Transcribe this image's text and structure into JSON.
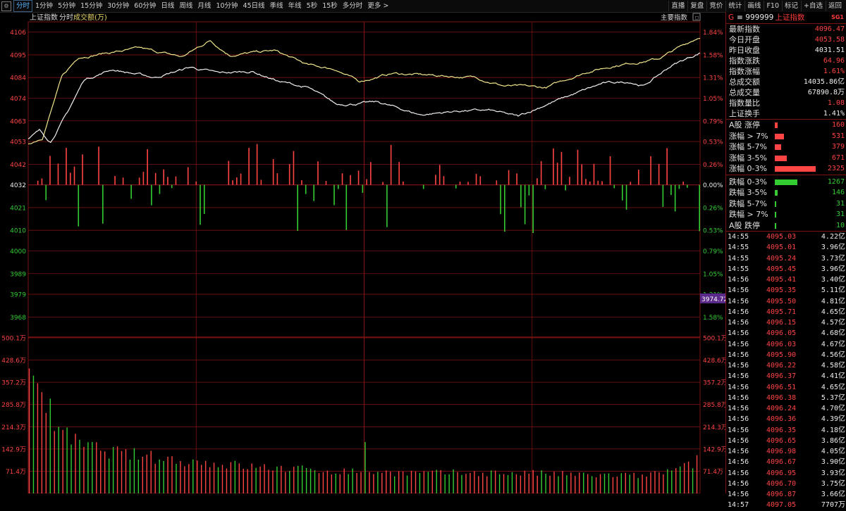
{
  "toolbar": {
    "tabs": [
      "分时",
      "1分钟",
      "5分钟",
      "15分钟",
      "30分钟",
      "60分钟",
      "日线",
      "周线",
      "月线",
      "10分钟",
      "45日线",
      "季线",
      "年线",
      "5秒",
      "15秒",
      "多分时",
      "更多 >"
    ],
    "active_tab": "分时",
    "right_buttons": [
      "直播",
      "复盘",
      "竞价",
      "统计",
      "画线",
      "F10",
      "标记",
      "+自选",
      "返回"
    ]
  },
  "chart_header": {
    "name": "上证指数",
    "mode": "分时",
    "volume_label": "成交额(万)",
    "indicator_button": "主要指数"
  },
  "sidebar": {
    "header": {
      "g": "G",
      "code": "≡ 999999",
      "name": "上证指数",
      "badge": "SG1"
    },
    "quote": [
      {
        "label": "最新指数",
        "value": "4096.47",
        "color": "red"
      },
      {
        "label": "今日开盘",
        "value": "4053.58",
        "color": "red"
      },
      {
        "label": "昨日收盘",
        "value": "4031.51",
        "color": "white"
      },
      {
        "label": "指数涨跌",
        "value": "64.96",
        "color": "red"
      },
      {
        "label": "指数涨幅",
        "value": "1.61%",
        "color": "red"
      },
      {
        "label": "总成交额",
        "value": "14035.86亿",
        "color": "white"
      },
      {
        "label": "总成交量",
        "value": "67890.8万",
        "color": "white"
      },
      {
        "label": "指数量比",
        "value": "1.08",
        "color": "red"
      },
      {
        "label": "上证换手",
        "value": "1.41%",
        "color": "white"
      }
    ],
    "breadth_up": [
      {
        "label": "A股 涨停",
        "value": "160"
      },
      {
        "label": "涨幅 > 7%",
        "value": "531"
      },
      {
        "label": "涨幅 5-7%",
        "value": "379"
      },
      {
        "label": "涨幅 3-5%",
        "value": "671"
      },
      {
        "label": "涨幅 0-3%",
        "value": "2325"
      }
    ],
    "breadth_down": [
      {
        "label": "跌幅 0-3%",
        "value": "1267"
      },
      {
        "label": "跌幅 3-5%",
        "value": "146"
      },
      {
        "label": "跌幅 5-7%",
        "value": "31"
      },
      {
        "label": "跌幅 > 7%",
        "value": "31"
      },
      {
        "label": "A股 跌停",
        "value": "10"
      }
    ],
    "ticks": [
      {
        "time": "14:55",
        "price": "4095.03",
        "amount": "4.22",
        "unit": "亿"
      },
      {
        "time": "14:55",
        "price": "4095.01",
        "amount": "3.96",
        "unit": "亿"
      },
      {
        "time": "14:55",
        "price": "4095.24",
        "amount": "3.73",
        "unit": "亿"
      },
      {
        "time": "14:55",
        "price": "4095.45",
        "amount": "3.96",
        "unit": "亿"
      },
      {
        "time": "14:56",
        "price": "4095.41",
        "amount": "3.40",
        "unit": "亿"
      },
      {
        "time": "14:56",
        "price": "4095.35",
        "amount": "5.11",
        "unit": "亿"
      },
      {
        "time": "14:56",
        "price": "4095.50",
        "amount": "4.81",
        "unit": "亿"
      },
      {
        "time": "14:56",
        "price": "4095.71",
        "amount": "4.65",
        "unit": "亿"
      },
      {
        "time": "14:56",
        "price": "4096.15",
        "amount": "4.57",
        "unit": "亿"
      },
      {
        "time": "14:56",
        "price": "4096.05",
        "amount": "4.68",
        "unit": "亿"
      },
      {
        "time": "14:56",
        "price": "4096.03",
        "amount": "4.67",
        "unit": "亿"
      },
      {
        "time": "14:56",
        "price": "4095.90",
        "amount": "4.56",
        "unit": "亿"
      },
      {
        "time": "14:56",
        "price": "4096.22",
        "amount": "4.58",
        "unit": "亿"
      },
      {
        "time": "14:56",
        "price": "4096.37",
        "amount": "4.41",
        "unit": "亿"
      },
      {
        "time": "14:56",
        "price": "4096.51",
        "amount": "4.65",
        "unit": "亿"
      },
      {
        "time": "14:56",
        "price": "4096.38",
        "amount": "5.37",
        "unit": "亿"
      },
      {
        "time": "14:56",
        "price": "4096.24",
        "amount": "4.70",
        "unit": "亿"
      },
      {
        "time": "14:56",
        "price": "4096.36",
        "amount": "4.39",
        "unit": "亿"
      },
      {
        "time": "14:56",
        "price": "4096.35",
        "amount": "4.18",
        "unit": "亿"
      },
      {
        "time": "14:56",
        "price": "4096.65",
        "amount": "3.86",
        "unit": "亿"
      },
      {
        "time": "14:56",
        "price": "4096.98",
        "amount": "4.05",
        "unit": "亿"
      },
      {
        "time": "14:56",
        "price": "4096.67",
        "amount": "3.90",
        "unit": "亿"
      },
      {
        "time": "14:56",
        "price": "4096.95",
        "amount": "3.93",
        "unit": "亿"
      },
      {
        "time": "14:56",
        "price": "4096.70",
        "amount": "3.75",
        "unit": "亿"
      },
      {
        "time": "14:56",
        "price": "4096.87",
        "amount": "3.66",
        "unit": "亿"
      },
      {
        "time": "14:57",
        "price": "4097.05",
        "amount": "7707",
        "unit": "万"
      }
    ]
  },
  "colors": {
    "up": "#ff4444",
    "down": "#33cc33",
    "grid": "#7a1212",
    "white_line": "#f0f0f0",
    "yellow_line": "#f0e68c",
    "crosshair_label_bg": "#5a2a8a"
  },
  "chart_data": {
    "type": "line",
    "price_axis": {
      "left_ticks": [
        4106,
        4095,
        4084,
        4074,
        4063,
        4053,
        4042,
        4032,
        4021,
        4010,
        4000,
        3989,
        3979,
        3968
      ],
      "right_ticks": [
        "1.84%",
        "1.58%",
        "1.31%",
        "1.05%",
        "0.79%",
        "0.53%",
        "0.26%",
        "0.00%",
        "0.26%",
        "0.53%",
        "0.79%",
        "1.05%",
        "1.31%",
        "1.58%"
      ],
      "ylim": [
        3963,
        4111
      ],
      "prev_close": 4032,
      "crosshair_value": "3974.72"
    },
    "volume_axis": {
      "ticks": [
        "500.1万",
        "428.6万",
        "357.2万",
        "285.8万",
        "214.3万",
        "142.9万",
        "71.4万"
      ],
      "ylim": [
        0,
        500.1
      ]
    },
    "minutes": 240,
    "series": [
      {
        "kind": "yellow",
        "keypoints": [
          [
            0,
            4052
          ],
          [
            5,
            4055
          ],
          [
            12,
            4084
          ],
          [
            18,
            4094
          ],
          [
            28,
            4096
          ],
          [
            40,
            4098
          ],
          [
            55,
            4094
          ],
          [
            65,
            4102
          ],
          [
            72,
            4095
          ],
          [
            88,
            4097
          ],
          [
            100,
            4090
          ],
          [
            110,
            4088
          ],
          [
            118,
            4082
          ],
          [
            130,
            4086
          ],
          [
            145,
            4085
          ],
          [
            160,
            4084
          ],
          [
            170,
            4080
          ],
          [
            185,
            4079
          ],
          [
            192,
            4083
          ],
          [
            200,
            4087
          ],
          [
            210,
            4090
          ],
          [
            225,
            4093
          ],
          [
            240,
            4104
          ]
        ]
      },
      {
        "kind": "white",
        "keypoints": [
          [
            0,
            4054
          ],
          [
            4,
            4058
          ],
          [
            8,
            4053
          ],
          [
            14,
            4067
          ],
          [
            20,
            4083
          ],
          [
            30,
            4088
          ],
          [
            45,
            4084
          ],
          [
            58,
            4089
          ],
          [
            68,
            4086
          ],
          [
            80,
            4087
          ],
          [
            90,
            4082
          ],
          [
            100,
            4079
          ],
          [
            110,
            4071
          ],
          [
            125,
            4072
          ],
          [
            140,
            4066
          ],
          [
            155,
            4068
          ],
          [
            165,
            4068
          ],
          [
            175,
            4065
          ],
          [
            185,
            4071
          ],
          [
            195,
            4076
          ],
          [
            205,
            4081
          ],
          [
            215,
            4082
          ],
          [
            220,
            4080
          ],
          [
            230,
            4090
          ],
          [
            240,
            4096
          ]
        ]
      }
    ],
    "volume_envelope": [
      [
        0,
        455
      ],
      [
        3,
        405
      ],
      [
        6,
        305
      ],
      [
        10,
        225
      ],
      [
        15,
        180
      ],
      [
        20,
        160
      ],
      [
        30,
        140
      ],
      [
        50,
        115
      ],
      [
        80,
        90
      ],
      [
        110,
        75
      ],
      [
        140,
        68
      ],
      [
        160,
        70
      ],
      [
        180,
        68
      ],
      [
        200,
        62
      ],
      [
        220,
        60
      ],
      [
        232,
        82
      ],
      [
        237,
        100
      ],
      [
        240,
        140
      ]
    ]
  }
}
